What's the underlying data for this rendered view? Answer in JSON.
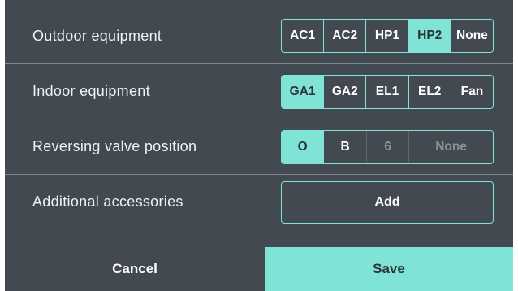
{
  "settings": {
    "rows": [
      {
        "label": "Outdoor equipment",
        "options": [
          "AC1",
          "AC2",
          "HP1",
          "HP2",
          "None"
        ],
        "selected": "HP2"
      },
      {
        "label": "Indoor equipment",
        "options": [
          "GA1",
          "GA2",
          "EL1",
          "EL2",
          "Fan"
        ],
        "selected": "GA1"
      },
      {
        "label": "Reversing valve position",
        "options": [
          "O",
          "B",
          "6",
          "None"
        ],
        "selected": "O",
        "disabled": [
          "6",
          "None"
        ]
      },
      {
        "label": "Additional accessories",
        "button_label": "Add"
      }
    ]
  },
  "footer": {
    "cancel_label": "Cancel",
    "save_label": "Save"
  },
  "colors": {
    "background": "#434950",
    "accent": "#7fe3d5",
    "divider": "#7e858b",
    "disabled_text": "#8a9197"
  }
}
